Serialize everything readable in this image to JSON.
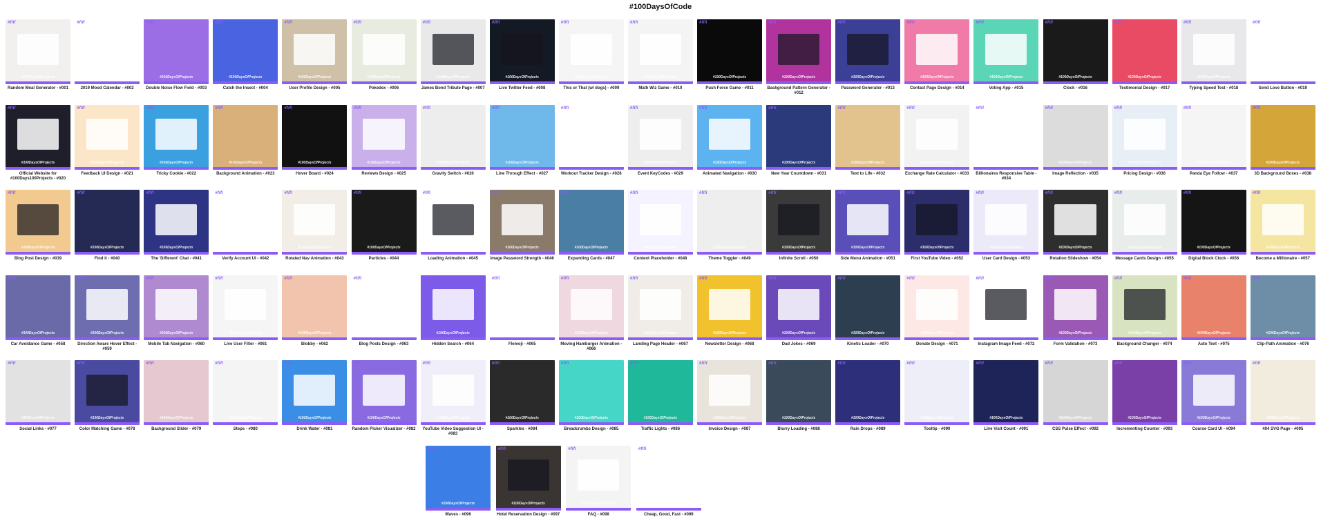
{
  "page": {
    "title": "#100DaysOfCode"
  },
  "tag_text": "#fifi",
  "foot_text": "#100DaysOfProjects",
  "accent": "#8b5cf6",
  "projects": [
    {
      "label": "Random Meal Generator - #001",
      "bg": "#f1f0ee",
      "style": "light"
    },
    {
      "label": "2019 Mood Calendar - #002",
      "bg": "#ffffff",
      "style": "light"
    },
    {
      "label": "Double Noise Flow Field - #003",
      "bg": "#9b6ee6",
      "style": "none"
    },
    {
      "label": "Catch the Insect - #004",
      "bg": "#4a63e0",
      "style": "none"
    },
    {
      "label": "User Profile Design - #005",
      "bg": "#cfc0a8",
      "style": "light"
    },
    {
      "label": "Pokedex - #006",
      "bg": "#e8ebe0",
      "style": "light"
    },
    {
      "label": "James Bond Tribute Page - #007",
      "bg": "#e9e9e9",
      "style": "dark"
    },
    {
      "label": "Live Twitter Feed - #008",
      "bg": "#141a24",
      "style": "dark"
    },
    {
      "label": "This or That (w/ dogs) - #009",
      "bg": "#f5f5f5",
      "style": "light"
    },
    {
      "label": "Math Wiz Game - #010",
      "bg": "#f4f4f4",
      "style": "light"
    },
    {
      "label": "Push Force Game - #011",
      "bg": "#0a0a0a",
      "style": "none"
    },
    {
      "label": "Background Pattern Generator - #012",
      "bg": "#b0339e",
      "style": "dark"
    },
    {
      "label": "Password Generator - #013",
      "bg": "#3b3f96",
      "style": "dark"
    },
    {
      "label": "Contact Page Design - #014",
      "bg": "#f07aa8",
      "style": "light"
    },
    {
      "label": "Voting App - #015",
      "bg": "#5ad6b6",
      "style": "light"
    },
    {
      "label": "Clock - #016",
      "bg": "#1a1a1a",
      "style": "none"
    },
    {
      "label": "Testimonial Design - #017",
      "bg": "#e94a64",
      "style": "none"
    },
    {
      "label": "Typing Speed Test - #018",
      "bg": "#e8e8ea",
      "style": "light"
    },
    {
      "label": "Send Love Button - #019",
      "bg": "#ffffff",
      "style": "light"
    },
    {
      "label": "Official Website for #100Days100Projects - #020",
      "bg": "#1f1f2b",
      "style": "light"
    },
    {
      "label": "Feedback UI Design - #021",
      "bg": "#fbe7c8",
      "style": "light"
    },
    {
      "label": "Tricky Cookie - #022",
      "bg": "#3aa0e0",
      "style": "light"
    },
    {
      "label": "Background Animation - #023",
      "bg": "#d9b07a",
      "style": "none"
    },
    {
      "label": "Hover Board - #024",
      "bg": "#111111",
      "style": "none"
    },
    {
      "label": "Reviews Design - #025",
      "bg": "#c9b0ea",
      "style": "light"
    },
    {
      "label": "Gravity Switch - #026",
      "bg": "#ededed",
      "style": "none"
    },
    {
      "label": "Line Through Effect - #027",
      "bg": "#6fb8ea",
      "style": "none"
    },
    {
      "label": "Workout Tracker Design - #028",
      "bg": "#ffffff",
      "style": "light"
    },
    {
      "label": "Event KeyCodes - #029",
      "bg": "#eeeeee",
      "style": "light"
    },
    {
      "label": "Animated Navigation - #030",
      "bg": "#5cb3f0",
      "style": "light"
    },
    {
      "label": "New Year Countdown - #031",
      "bg": "#2a3a7a",
      "style": "none"
    },
    {
      "label": "Text to Life - #032",
      "bg": "#e2c38e",
      "style": "none"
    },
    {
      "label": "Exchange Rate Calculator - #033",
      "bg": "#f2f2f2",
      "style": "light"
    },
    {
      "label": "Billionaires Responsive Table - #034",
      "bg": "#ffffff",
      "style": "light"
    },
    {
      "label": "Image Reflection - #035",
      "bg": "#dcdcdc",
      "style": "none"
    },
    {
      "label": "Pricing Design - #036",
      "bg": "#e8eef5",
      "style": "light"
    },
    {
      "label": "Panda Eye Follow - #037",
      "bg": "#f5f5f5",
      "style": "none"
    },
    {
      "label": "3D Background Boxes - #038",
      "bg": "#d4a63a",
      "style": "none"
    },
    {
      "label": "Blog Post Design - #039",
      "bg": "#f2c98e",
      "style": "dark"
    },
    {
      "label": "Find it - #040",
      "bg": "#242a54",
      "style": "none"
    },
    {
      "label": "The 'Different' Chat - #041",
      "bg": "#2d3484",
      "style": "light"
    },
    {
      "label": "Verify Account UI - #042",
      "bg": "#ffffff",
      "style": "light"
    },
    {
      "label": "Rotated Nav Animation - #043",
      "bg": "#f2ede6",
      "style": "light"
    },
    {
      "label": "Particles - #044",
      "bg": "#1a1a1a",
      "style": "none"
    },
    {
      "label": "Loading Animation - #045",
      "bg": "#ffffff",
      "style": "dark"
    },
    {
      "label": "Image Password Strength - #046",
      "bg": "#8a7a6a",
      "style": "light"
    },
    {
      "label": "Expanding Cards - #047",
      "bg": "#4b7ea5",
      "style": "none"
    },
    {
      "label": "Content Placeholder - #048",
      "bg": "#f5f3ff",
      "style": "light"
    },
    {
      "label": "Theme Toggler - #049",
      "bg": "#eeeeee",
      "style": "none"
    },
    {
      "label": "Infinite Scroll - #050",
      "bg": "#3a3a3a",
      "style": "dark"
    },
    {
      "label": "Side Menu Animation - #051",
      "bg": "#5a4fb8",
      "style": "light"
    },
    {
      "label": "First YouTube Video - #052",
      "bg": "#2b2e6a",
      "style": "dark"
    },
    {
      "label": "User Card Design - #053",
      "bg": "#eceaf8",
      "style": "light"
    },
    {
      "label": "Rotation Slideshow - #054",
      "bg": "#2e2e2e",
      "style": "light"
    },
    {
      "label": "Message Cards Design - #055",
      "bg": "#e8ecea",
      "style": "light"
    },
    {
      "label": "Digital Block Clock - #056",
      "bg": "#151515",
      "style": "none"
    },
    {
      "label": "Become a Millionaire - #057",
      "bg": "#f4e6a0",
      "style": "light"
    },
    {
      "label": "Car Avoidance Game - #058",
      "bg": "#6a6aa8",
      "style": "none"
    },
    {
      "label": "Direction Aware Hover Effect - #059",
      "bg": "#6d6db0",
      "style": "light"
    },
    {
      "label": "Mobile Tab Navigation - #060",
      "bg": "#b08ad0",
      "style": "light"
    },
    {
      "label": "Live User Filter - #061",
      "bg": "#f5f5f5",
      "style": "light"
    },
    {
      "label": "Blobby - #062",
      "bg": "#f2c4ae",
      "style": "none"
    },
    {
      "label": "Blog Posts Design - #063",
      "bg": "#ffffff",
      "style": "light"
    },
    {
      "label": "Hidden Search - #064",
      "bg": "#7b5be8",
      "style": "light"
    },
    {
      "label": "Flemoji - #065",
      "bg": "#ffffff",
      "style": "light"
    },
    {
      "label": "Moving Hamburger Animation - #066",
      "bg": "#f0d8e0",
      "style": "light"
    },
    {
      "label": "Landing Page Header - #067",
      "bg": "#f0ede8",
      "style": "light"
    },
    {
      "label": "Newsletter Design - #068",
      "bg": "#f2c12e",
      "style": "light"
    },
    {
      "label": "Dad Jokes - #069",
      "bg": "#6a4ab8",
      "style": "light"
    },
    {
      "label": "Kinetic Loader - #070",
      "bg": "#2d3e50",
      "style": "none"
    },
    {
      "label": "Donate Design - #071",
      "bg": "#fde8e6",
      "style": "light"
    },
    {
      "label": "Instagram Image Feed - #072",
      "bg": "#ffffff",
      "style": "dark"
    },
    {
      "label": "Form Validation - #073",
      "bg": "#9b59b6",
      "style": "light"
    },
    {
      "label": "Background Changer - #074",
      "bg": "#d8e3c2",
      "style": "dark"
    },
    {
      "label": "Auto Text - #075",
      "bg": "#e8826a",
      "style": "none"
    },
    {
      "label": "Clip-Path Animation - #076",
      "bg": "#6e8ea8",
      "style": "none"
    },
    {
      "label": "Social Links - #077",
      "bg": "#e2e2e2",
      "style": "none"
    },
    {
      "label": "Color Matching Game - #078",
      "bg": "#4a4aa0",
      "style": "dark"
    },
    {
      "label": "Background Slider - #079",
      "bg": "#e6c8d0",
      "style": "none"
    },
    {
      "label": "Steps - #080",
      "bg": "#f4f4f4",
      "style": "none"
    },
    {
      "label": "Drink Water - #081",
      "bg": "#3a8ee6",
      "style": "light"
    },
    {
      "label": "Random Picker Visualizer - #082",
      "bg": "#8a6ae0",
      "style": "light"
    },
    {
      "label": "YouTube Video Suggestion UI - #083",
      "bg": "#f0eef8",
      "style": "light"
    },
    {
      "label": "Sparkles - #084",
      "bg": "#2a2a2a",
      "style": "none"
    },
    {
      "label": "Breadcrumbs Design - #085",
      "bg": "#46d6c8",
      "style": "none"
    },
    {
      "label": "Traffic Lights - #086",
      "bg": "#1fb89a",
      "style": "none"
    },
    {
      "label": "Invoice Design - #087",
      "bg": "#e8e4dc",
      "style": "light"
    },
    {
      "label": "Blurry Loading - #088",
      "bg": "#3a4a5a",
      "style": "none"
    },
    {
      "label": "Rain Drops - #089",
      "bg": "#2d2f7a",
      "style": "none"
    },
    {
      "label": "Tooltip - #090",
      "bg": "#eeeef8",
      "style": "none"
    },
    {
      "label": "Live Visit Count - #091",
      "bg": "#1e2458",
      "style": "none"
    },
    {
      "label": "CSS Pulse Effect - #092",
      "bg": "#d6d6d6",
      "style": "none"
    },
    {
      "label": "Incrementing Counter - #093",
      "bg": "#7b3fa8",
      "style": "none"
    },
    {
      "label": "Course Card UI - #094",
      "bg": "#8a7ad8",
      "style": "light"
    },
    {
      "label": "404 SVG Page - #095",
      "bg": "#f2ecdf",
      "style": "none"
    },
    {
      "label": "Waves - #096",
      "bg": "#3a7ee6",
      "style": "none"
    },
    {
      "label": "Hotel Reservation Design - #097",
      "bg": "#3a3432",
      "style": "dark"
    },
    {
      "label": "FAQ - #098",
      "bg": "#f4f4f4",
      "style": "light"
    },
    {
      "label": "Cheap, Good, Fast - #099",
      "bg": "#ffffff",
      "style": "light"
    }
  ]
}
